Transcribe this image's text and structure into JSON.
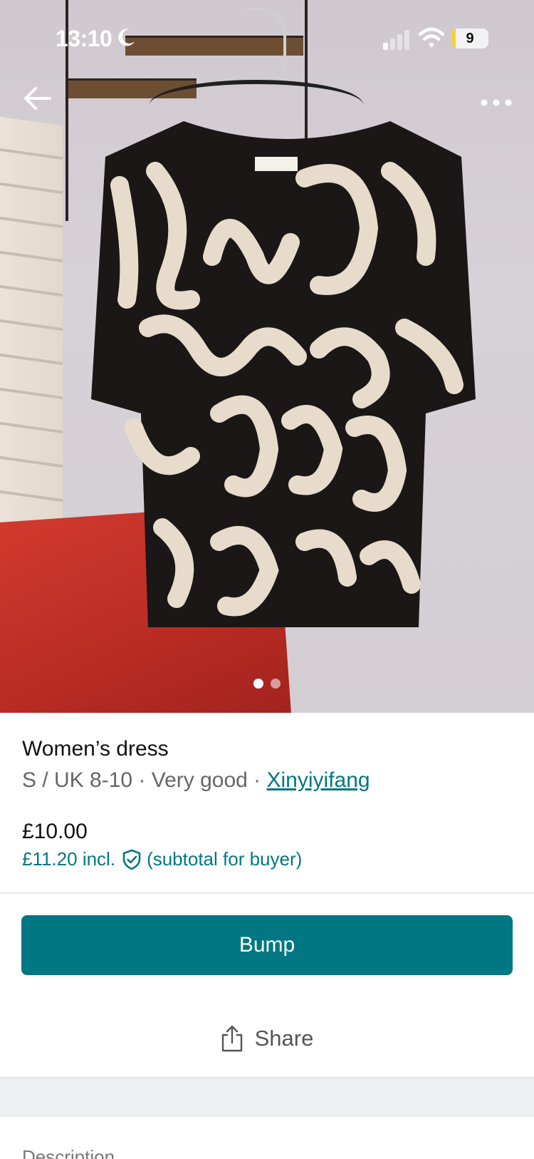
{
  "status_bar": {
    "time": "13:10",
    "battery": "9",
    "battery_level": 0.09,
    "icons": [
      "moon-icon",
      "signal-icon",
      "wifi-icon",
      "battery-icon"
    ]
  },
  "nav": {
    "back_icon": "arrow-left-icon",
    "more_icon": "more-horizontal-icon"
  },
  "gallery": {
    "total_photos": 2,
    "current_photo": 1
  },
  "item": {
    "title": "Women’s dress",
    "size_condition": "S / UK 8-10 · Very good · ",
    "brand": "Xinyiyifang",
    "price": "£10.00",
    "price_incl": "£11.20 incl.",
    "price_note": "(subtotal for buyer)"
  },
  "actions": {
    "bump_label": "Bump",
    "share_label": "Share"
  },
  "description": {
    "heading": "Description"
  },
  "colors": {
    "accent": "#007782",
    "battery_low": "#f6cf3a"
  }
}
